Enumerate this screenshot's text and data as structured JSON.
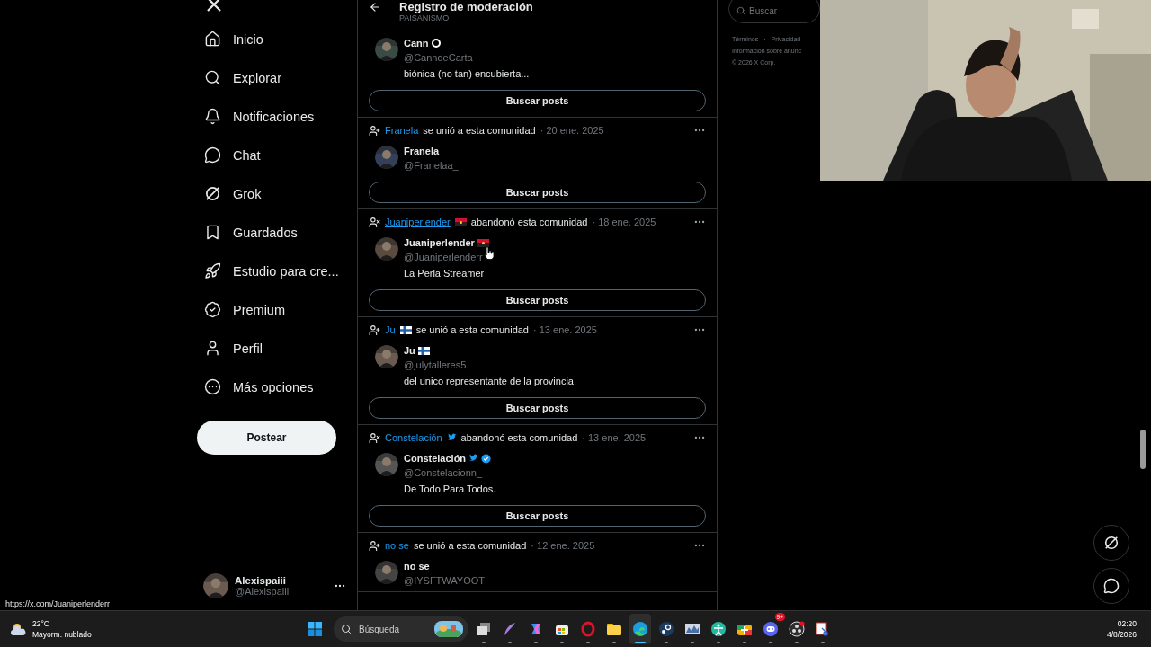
{
  "sidebar": {
    "items": [
      {
        "kind": "home",
        "label": "Inicio"
      },
      {
        "kind": "search",
        "label": "Explorar"
      },
      {
        "kind": "bell",
        "label": "Notificaciones"
      },
      {
        "kind": "chat",
        "label": "Chat"
      },
      {
        "kind": "grok",
        "label": "Grok"
      },
      {
        "kind": "bookmark",
        "label": "Guardados"
      },
      {
        "kind": "rocket",
        "label": "Estudio para cre..."
      },
      {
        "kind": "badge",
        "label": "Premium"
      },
      {
        "kind": "person",
        "label": "Perfil"
      },
      {
        "kind": "more",
        "label": "Más opciones"
      }
    ],
    "post_button": "Postear",
    "account": {
      "name": "Alexispaiii",
      "handle": "@Alexispaiii"
    }
  },
  "header": {
    "title": "Registro de moderación",
    "subtitle": "PAISANISMO"
  },
  "log": [
    {
      "name": "Cann",
      "name_badge": {
        "kind": "ring"
      },
      "handle": "@CanndeCarta",
      "bio": "biónica (no tan) encubierta...",
      "verified": false,
      "button": "Buscar posts"
    },
    {
      "kind": "joined",
      "user": "Franela",
      "hovered": false,
      "text": "se unió a esta comunidad",
      "date": "· 20 ene. 2025",
      "name": "Franela",
      "handle": "@Franelaa_",
      "verified": false,
      "button": "Buscar posts"
    },
    {
      "kind": "left",
      "user": "Juaniperlender",
      "hovered": true,
      "name_badge": {
        "kind": "flag_red"
      },
      "text": "abandonó esta comunidad",
      "date": "· 18 ene. 2025",
      "name": "Juaniperlender",
      "handle": "@Juaniperlenderr",
      "bio": "La Perla Streamer",
      "verified": false,
      "button": "Buscar posts"
    },
    {
      "kind": "joined",
      "user": "Ju",
      "hovered": false,
      "name_badge": {
        "kind": "flag_cross"
      },
      "text": "se unió a esta comunidad",
      "date": "· 13 ene. 2025",
      "name": "Ju",
      "handle": "@julytalleres5",
      "bio": "del unico representante de la provincia.",
      "verified": false,
      "button": "Buscar posts"
    },
    {
      "kind": "left",
      "user": "Constelación",
      "hovered": false,
      "name_badge": {
        "kind": "bird"
      },
      "text": "abandonó esta comunidad",
      "date": "· 13 ene. 2025",
      "name": "Constelación",
      "handle": "@Constelacionn_",
      "bio": "De Todo Para Todos.",
      "verified": true,
      "button": "Buscar posts"
    },
    {
      "kind": "joined",
      "user": "no se",
      "hovered": false,
      "text": "se unió a esta comunidad",
      "date": "· 12 ene. 2025",
      "name": "no se",
      "handle": "@IYSFTWAYOOT",
      "verified": false
    }
  ],
  "search": {
    "placeholder": "Buscar"
  },
  "footer": {
    "links": [
      "Términos",
      "·",
      "Privacidad"
    ],
    "ads": "Información sobre anunc",
    "copyright": "© 2026 X Corp."
  },
  "status_url": "https://x.com/Juaniperlenderr",
  "taskbar": {
    "weather": {
      "temp": "22°C",
      "text": "Mayorm. nublado"
    },
    "search": {
      "placeholder": "Búsqueda"
    },
    "apps": [
      {
        "kind": "taskview",
        "active": false
      },
      {
        "kind": "pen",
        "active": false
      },
      {
        "kind": "copilot",
        "active": false
      },
      {
        "kind": "store",
        "active": false
      },
      {
        "kind": "opera",
        "active": false
      },
      {
        "kind": "folder",
        "active": false
      },
      {
        "kind": "edge",
        "active": true
      },
      {
        "kind": "steam",
        "active": false
      },
      {
        "kind": "monitor",
        "active": false
      },
      {
        "kind": "figure",
        "active": false
      },
      {
        "kind": "plus",
        "active": false
      },
      {
        "kind": "discord",
        "active": false,
        "badge": "9+"
      },
      {
        "kind": "obs",
        "active": false
      },
      {
        "kind": "snip",
        "active": false
      }
    ],
    "time": "02:20",
    "date": "4/8/2026"
  }
}
